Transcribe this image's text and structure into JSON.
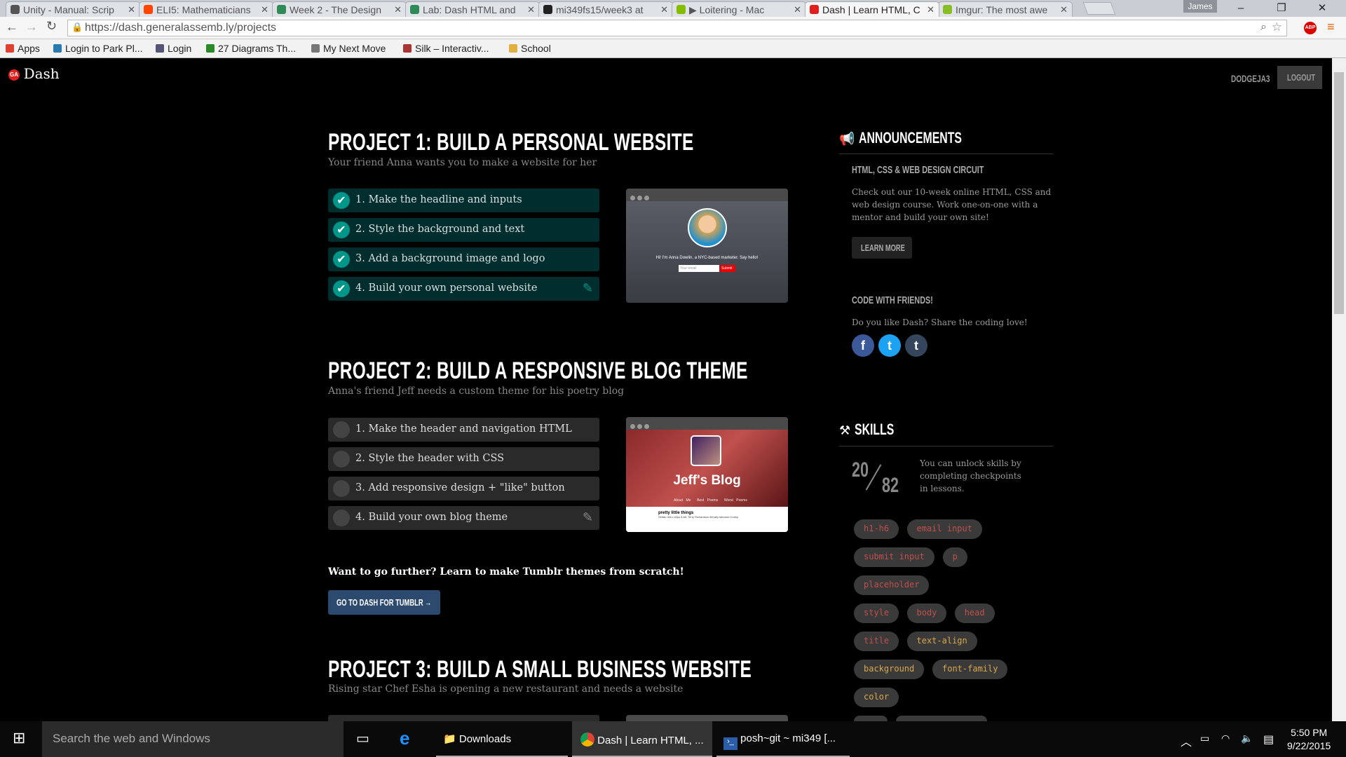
{
  "browser": {
    "tabs": [
      {
        "title": "Unity - Manual: Scrip",
        "favicon_color": "#555"
      },
      {
        "title": "ELI5: Mathematicians",
        "favicon_color": "#ff4500"
      },
      {
        "title": "Week 2 - The Design",
        "favicon_color": "#2e8b57"
      },
      {
        "title": "Lab: Dash HTML and",
        "favicon_color": "#2e8b57"
      },
      {
        "title": "mi349fs15/week3 at",
        "favicon_color": "#222"
      },
      {
        "title": "▶ Loitering - Mac",
        "favicon_color": "#84bd00"
      },
      {
        "title": "Dash | Learn HTML, C",
        "favicon_color": "#e0201c"
      },
      {
        "title": "Imgur: The most awe",
        "favicon_color": "#85bf25"
      }
    ],
    "active_tab": 6,
    "user_badge": "James",
    "url": "https://dash.generalassemb.ly/projects",
    "bookmarks": [
      "Apps",
      "Login to Park Pl...",
      "Login",
      "27 Diagrams Th...",
      "My Next Move",
      "Silk – Interactiv...",
      "School"
    ]
  },
  "header": {
    "logo": "Dash",
    "username": "DODGEJA3",
    "logout": "LOGOUT"
  },
  "projects": [
    {
      "title": "PROJECT 1: BUILD A PERSONAL WEBSITE",
      "subtitle": "Your friend Anna wants you to make a website for her",
      "tasks": [
        "1. Make the headline and inputs",
        "2. Style the background and text",
        "3. Add a background image and logo",
        "4. Build your own personal website"
      ],
      "completed": 4,
      "preview": {
        "text": "Hi! I'm Anna Dowlin, a NYC-based marketer. Say hello!",
        "placeholder": "Your email",
        "button": "Submit"
      }
    },
    {
      "title": "PROJECT 2: BUILD A RESPONSIVE BLOG THEME",
      "subtitle": "Anna's friend Jeff needs a custom theme for his poetry blog",
      "tasks": [
        "1. Make the header and navigation HTML",
        "2. Style the header with CSS",
        "3. Add responsive design + \"like\" button",
        "4. Build your own blog theme"
      ],
      "completed": 0,
      "preview": {
        "title": "Jeff's Blog",
        "nav": [
          "About Me",
          "Best Poems",
          "Worst Poems"
        ],
        "post_title": "pretty little things",
        "post_text": "Seitan retro chips 8-bit, Terry Richardson literally tattooed Cosby"
      }
    },
    {
      "title": "PROJECT 3: BUILD A SMALL BUSINESS WEBSITE",
      "subtitle": "Rising star Chef Esha is opening a new restaurant and needs a website"
    }
  ],
  "tumblr": {
    "text": "Want to go further? Learn to make Tumblr themes from scratch!",
    "button": "GO TO DASH FOR TUMBLR →"
  },
  "announcements": {
    "heading": "ANNOUNCEMENTS",
    "circuit_title": "HTML, CSS & WEB DESIGN CIRCUIT",
    "circuit_text": "Check out our 10-week online HTML, CSS and web design course. Work one-on-one with a mentor and build your own site!",
    "learn_more": "LEARN MORE",
    "friends_title": "CODE WITH FRIENDS!",
    "friends_text": "Do you like Dash? Share the coding love!",
    "social": [
      {
        "label": "f",
        "color": "#3b5998"
      },
      {
        "label": "t",
        "color": "#1da1f2"
      },
      {
        "label": "t",
        "color": "#35465c"
      }
    ]
  },
  "skills": {
    "heading": "SKILLS",
    "unlocked": "20",
    "total": "82",
    "text": "You can unlock skills by completing checkpoints in lessons.",
    "tags": [
      {
        "label": "h1-h6",
        "color": "#c0504d"
      },
      {
        "label": "email input",
        "color": "#c0504d"
      },
      {
        "label": "submit input",
        "color": "#c0504d"
      },
      {
        "label": "p",
        "color": "#c0504d"
      },
      {
        "label": "placeholder",
        "color": "#c0504d"
      },
      {
        "label": "style",
        "color": "#c0504d"
      },
      {
        "label": "body",
        "color": "#c0504d"
      },
      {
        "label": "head",
        "color": "#c0504d"
      },
      {
        "label": "title",
        "color": "#c0504d"
      },
      {
        "label": "text-align",
        "color": "#d9a84a"
      },
      {
        "label": "background",
        "color": "#d9a84a"
      },
      {
        "label": "font-family",
        "color": "#d9a84a"
      },
      {
        "label": "color",
        "color": "#d9a84a"
      }
    ]
  },
  "taskbar": {
    "search": "Search the web and Windows",
    "apps": [
      "Downloads",
      "Dash | Learn HTML, ...",
      "posh~git ~ mi349 [..."
    ],
    "time": "5:50 PM",
    "date": "9/22/2015"
  }
}
